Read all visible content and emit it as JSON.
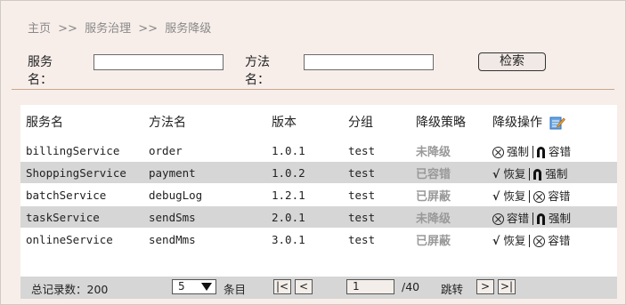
{
  "breadcrumb": {
    "items": [
      "主页",
      "服务治理",
      "服务降级"
    ],
    "separator": ">>"
  },
  "search": {
    "service_label": "服务名：",
    "service_value": "",
    "method_label": "方法名：",
    "method_value": "",
    "button_label": "检索"
  },
  "table": {
    "headers": [
      "服务名",
      "方法名",
      "版本",
      "分组",
      "降级策略",
      "降级操作"
    ],
    "rows": [
      {
        "service": "billingService",
        "method": "order",
        "version": "1.0.1",
        "group": "test",
        "status": "未降级",
        "ops": [
          {
            "icon": "circle-x-icon",
            "label": "强制"
          },
          {
            "icon": "bolt-icon",
            "label": "容错"
          }
        ]
      },
      {
        "service": "ShoppingService",
        "method": "payment",
        "version": "1.0.2",
        "group": "test",
        "status": "已容错",
        "ops": [
          {
            "icon": "check-icon",
            "label": "恢复"
          },
          {
            "icon": "bolt-icon",
            "label": "强制"
          }
        ]
      },
      {
        "service": "batchService",
        "method": "debugLog",
        "version": "1.2.1",
        "group": "test",
        "status": "已屏蔽",
        "ops": [
          {
            "icon": "check-icon",
            "label": "恢复"
          },
          {
            "icon": "circle-x-icon",
            "label": "容错"
          }
        ]
      },
      {
        "service": "taskService",
        "method": "sendSms",
        "version": "2.0.1",
        "group": "test",
        "status": "未降级",
        "ops": [
          {
            "icon": "circle-x-icon",
            "label": "容错"
          },
          {
            "icon": "bolt-icon",
            "label": "强制"
          }
        ]
      },
      {
        "service": "onlineService",
        "method": "sendMms",
        "version": "3.0.1",
        "group": "test",
        "status": "已屏蔽",
        "ops": [
          {
            "icon": "check-icon",
            "label": "恢复"
          },
          {
            "icon": "circle-x-icon",
            "label": "容错"
          }
        ]
      }
    ]
  },
  "pagination": {
    "total_label": "总记录数：200",
    "page_size": "5",
    "page_size_unit": "条目",
    "first": "|<",
    "prev": "<",
    "current_page": "1",
    "total_pages": "/40",
    "jump_label": "跳转",
    "next": ">",
    "last": ">|"
  }
}
